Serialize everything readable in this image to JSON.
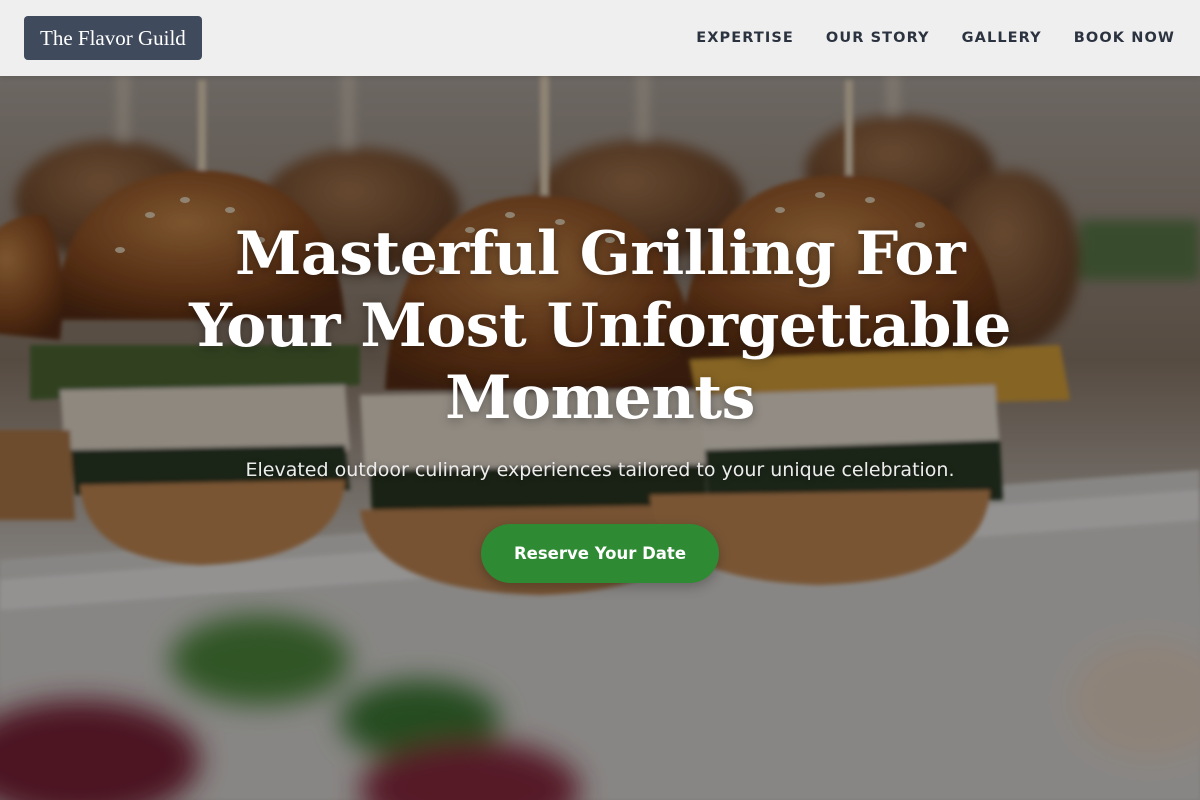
{
  "navbar": {
    "brand": "The Flavor Guild",
    "links": [
      "EXPERTISE",
      "OUR STORY",
      "GALLERY",
      "BOOK NOW"
    ]
  },
  "hero": {
    "title_lines": [
      "Masterful Grilling For",
      "Your Most Unforgettable",
      "Moments"
    ],
    "subtitle": "Elevated outdoor culinary experiences tailored to your unique celebration.",
    "cta_label": "Reserve Your Date",
    "background_image": "grilled-slider-burgers-photo"
  },
  "colors": {
    "navbar_bg": "#f5f5f5",
    "brand_bg": "#3f4a5c",
    "nav_text": "#2c3340",
    "cta_bg": "#2f8a34",
    "hero_text": "#ffffff"
  }
}
